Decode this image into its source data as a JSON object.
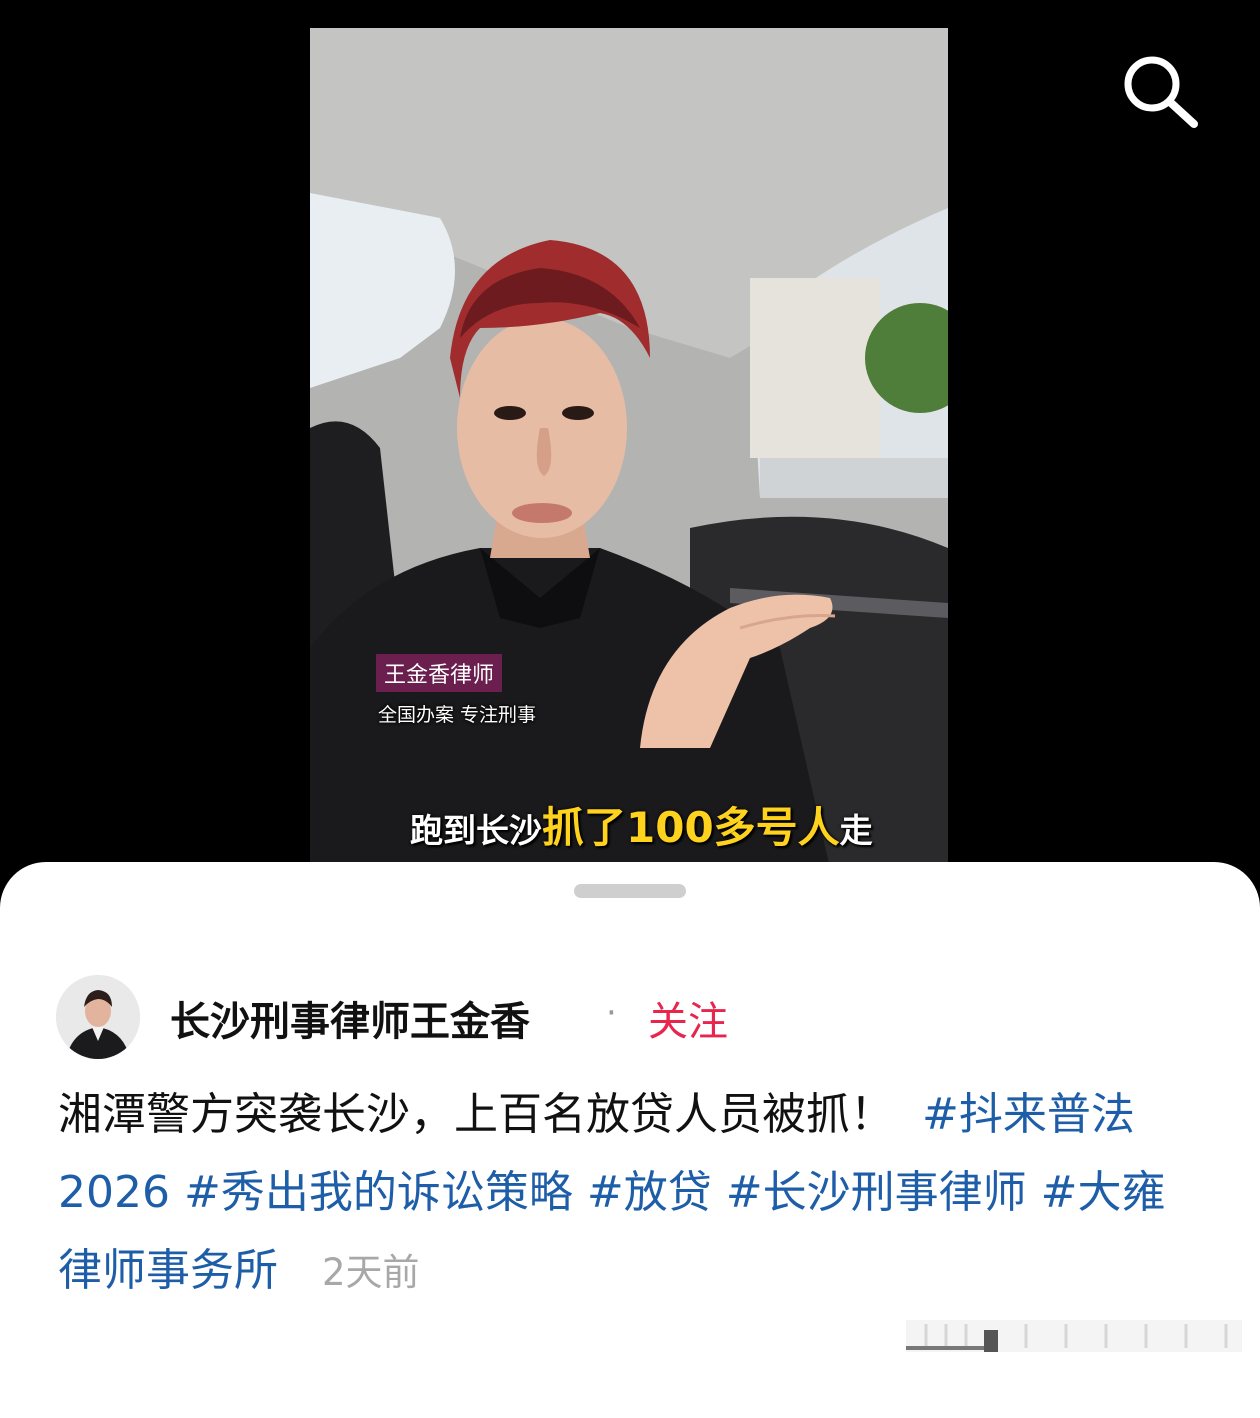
{
  "video": {
    "name_tag": "王金香律师",
    "name_sub": "全国办案 专注刑事",
    "subtitle_pre": "跑到长沙",
    "subtitle_hl": "抓了100多号人",
    "subtitle_post": "走"
  },
  "post": {
    "author": "长沙刑事律师王金香",
    "separator": "·",
    "follow_label": "关注",
    "text": "湘潭警方突袭长沙，上百名放贷人员被抓！",
    "hashtags": [
      "#抖来普法2026",
      "#秀出我的诉讼策略",
      "#放贷",
      "#长沙刑事律师",
      "#大雍律师事务所"
    ],
    "time": "2天前"
  },
  "icons": {
    "search": "search-icon"
  },
  "colors": {
    "follow": "#e8254d",
    "hashtag": "#1e5ea8",
    "name_tag_bg": "#6b1f4e",
    "subtitle_highlight": "#ffd21e"
  }
}
